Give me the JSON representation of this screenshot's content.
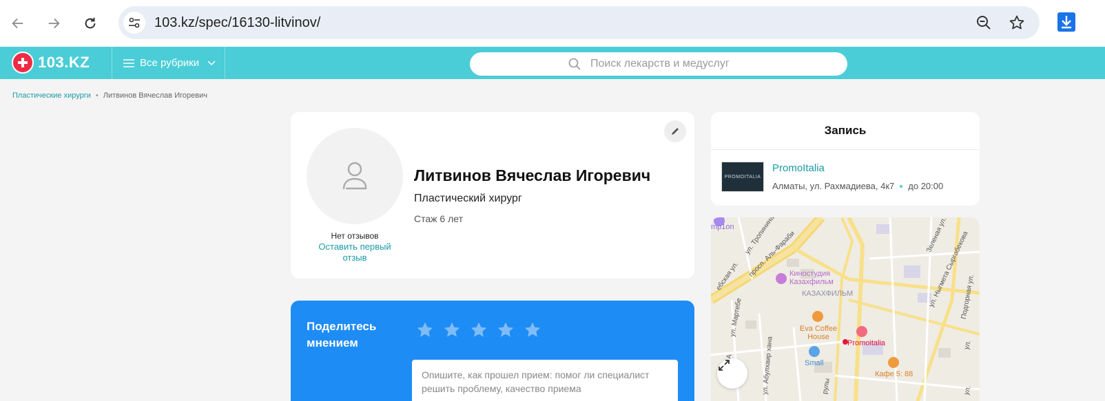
{
  "browser": {
    "url_host": "103.kz",
    "url_path": "/spec/16130-litvinov/"
  },
  "header": {
    "logo_text": "103.KZ",
    "rubrics_label": "Все рубрики",
    "search_placeholder": "Поиск лекарств и медуслуг",
    "accent_color": "#4acdd6",
    "logo_color": "#ee2b47"
  },
  "breadcrumb": {
    "items": [
      "Пластические хирурги",
      "Литвинов Вячеслав Игоревич"
    ]
  },
  "profile": {
    "name": "Литвинов Вячеслав Игоревич",
    "specialty": "Пластический хирург",
    "experience": "Стаж 6 лет",
    "reviews_status": "Нет отзывов",
    "review_link": "Оставить первый отзыв"
  },
  "share": {
    "title": "Поделитесь мнением",
    "stars_count": 5,
    "textarea_placeholder": "Опишите, как прошел прием: помог ли специалист решить проблему, качество приема",
    "bg_color": "#1e8cf5"
  },
  "booking": {
    "title": "Запись",
    "clinic_logo_text": "PROMOITALIA",
    "clinic_name": "PromoItalia",
    "clinic_address": "Алматы, ул. Рахмадиева, 4к7",
    "clinic_hours": "до 20:00"
  },
  "map": {
    "labels": {
      "street1": "просп. Аль-Фараби",
      "street2": "ул. Тропинина",
      "street3": "ул. Мартебе",
      "street4": "ул. Абулхаир хана",
      "street5": "ул. Ныгмета Сыргабекова",
      "street6": "Зеленая ул.",
      "street7": "Подгорная ул.",
      "district": "КАЗАХФИЛЬМ",
      "poi1": "Киностудия Казахфильм",
      "poi2": "Eva Coffee House",
      "poi3": "Promoitalia",
      "poi4": "Small",
      "poi5": "Кафе 5: 88",
      "poi6": "mp1on",
      "street8": "ебская ул.",
      "street9": "ул. А",
      "street10": "рулы",
      "street11": "ул.",
      "street12": "ул."
    }
  }
}
